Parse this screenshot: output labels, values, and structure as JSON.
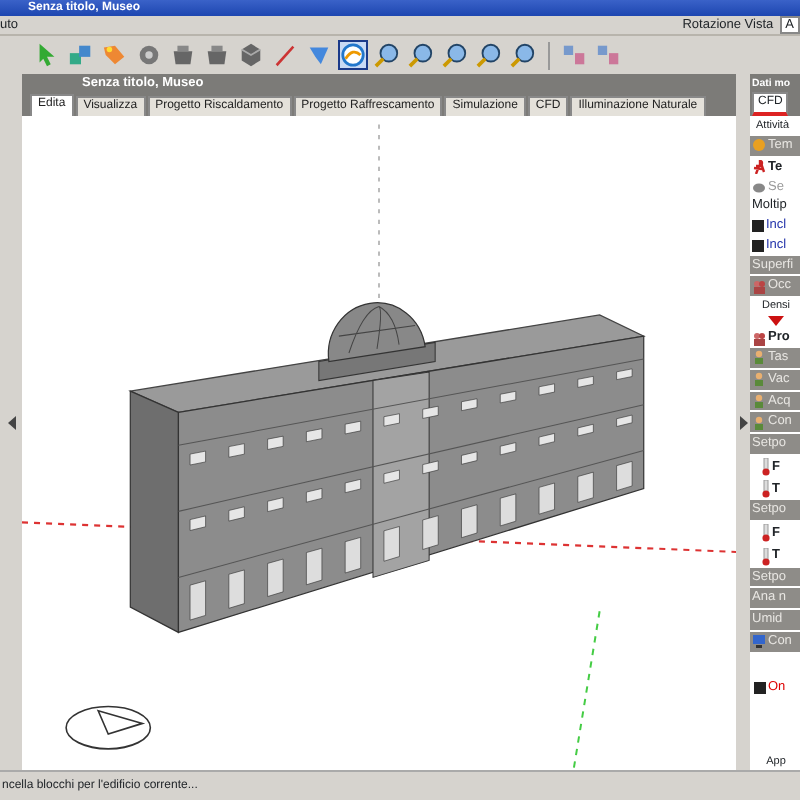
{
  "window": {
    "title": "Senza titolo, Museo"
  },
  "menu": [
    {
      "label": "uto"
    }
  ],
  "view_rotation": {
    "label": "Rotazione Vista",
    "value": "A"
  },
  "toolbar": [
    {
      "kind": "arrow",
      "selected": false
    },
    {
      "kind": "blocks",
      "selected": false
    },
    {
      "kind": "tag",
      "selected": false
    },
    {
      "kind": "cog",
      "selected": false
    },
    {
      "kind": "pot",
      "selected": false
    },
    {
      "kind": "pot",
      "selected": false
    },
    {
      "kind": "cube",
      "selected": false
    },
    {
      "kind": "pen",
      "selected": false
    },
    {
      "kind": "shape",
      "selected": false
    },
    {
      "kind": "orbit",
      "selected": true
    },
    {
      "kind": "zoom",
      "selected": false
    },
    {
      "kind": "zoom",
      "selected": false
    },
    {
      "kind": "zoom",
      "selected": false
    },
    {
      "kind": "zoom",
      "selected": false
    },
    {
      "kind": "zoom",
      "selected": false
    },
    {
      "kind": "separator"
    },
    {
      "kind": "grid",
      "selected": false
    },
    {
      "kind": "grid",
      "selected": false
    }
  ],
  "document": {
    "title": "Senza titolo, Museo"
  },
  "tabs": [
    {
      "label": "Edita",
      "selected": true
    },
    {
      "label": "Visualizza",
      "selected": false
    },
    {
      "label": "Progetto Riscaldamento",
      "selected": false
    },
    {
      "label": "Progetto Raffrescamento",
      "selected": false
    },
    {
      "label": "Simulazione",
      "selected": false
    },
    {
      "label": "CFD",
      "selected": false
    },
    {
      "label": "Illuminazione Naturale",
      "selected": false
    }
  ],
  "side_panel": {
    "title": "Dati mo",
    "tabs": [
      {
        "label": "CFD",
        "selected": true
      }
    ],
    "subtitle": "Attività",
    "rows": [
      {
        "kind": "group",
        "label": "Tem"
      },
      {
        "kind": "item",
        "label": "Te"
      },
      {
        "kind": "muted",
        "label": "Se"
      },
      {
        "kind": "text",
        "label": "Moltip"
      },
      {
        "kind": "check",
        "checked": true,
        "label": "Incl"
      },
      {
        "kind": "check",
        "checked": true,
        "label": "Incl"
      },
      {
        "kind": "group",
        "label": "Superfi"
      },
      {
        "kind": "group",
        "label": "Occ"
      },
      {
        "kind": "caption",
        "label": "Densi"
      },
      {
        "kind": "marker"
      },
      {
        "kind": "item",
        "label": "Pro"
      },
      {
        "kind": "group",
        "label": "Tas"
      },
      {
        "kind": "group",
        "label": "Vac"
      },
      {
        "kind": "group",
        "label": "Acq"
      },
      {
        "kind": "group",
        "label": "Con"
      },
      {
        "kind": "group",
        "label": "Setpo"
      },
      {
        "kind": "thermo",
        "label": "F"
      },
      {
        "kind": "thermo",
        "label": "T"
      },
      {
        "kind": "group",
        "label": "Setpo"
      },
      {
        "kind": "thermo",
        "label": "F"
      },
      {
        "kind": "thermo",
        "label": "T"
      },
      {
        "kind": "group",
        "label": "Setpo"
      },
      {
        "kind": "group",
        "label": "Ana n"
      },
      {
        "kind": "group",
        "label": "Umid"
      },
      {
        "kind": "group",
        "label": "Con"
      },
      {
        "kind": "check",
        "checked": true,
        "alert": true,
        "label": "On"
      },
      {
        "kind": "caption",
        "label": "App"
      }
    ]
  },
  "status_bar": {
    "text": "ncella blocchi per l'edificio corrente..."
  }
}
